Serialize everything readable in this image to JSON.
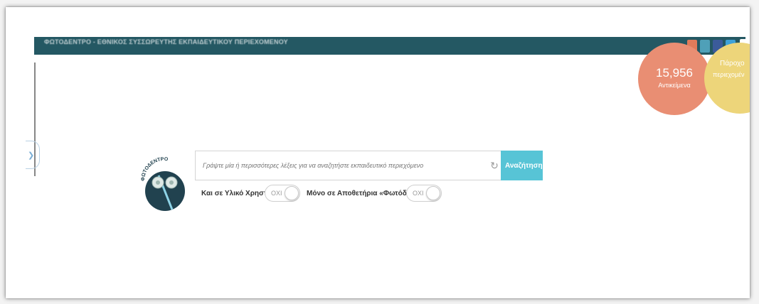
{
  "header": {
    "title": "ΦΩΤΟΔΕΝΤΡΟ - ΕΘΝΙΚΟΣ ΣΥΣΣΩΡΕΥΤΗΣ ΕΚΠΑΙΔΕΥΤΙΚΟΥ ΠΕΡΙΕΧΟΜΕΝΟΥ",
    "search_placeholder": "Αναζήτ...",
    "social_icons": [
      "rss-icon",
      "email-icon",
      "facebook-icon",
      "twitter-icon"
    ]
  },
  "stats": {
    "objects_count": "15,956",
    "objects_label": "Αντικείμενα",
    "providers_line1": "Πάροχο",
    "providers_line2": "περιεχομέν"
  },
  "logo": {
    "text": "ΦΩΤΟΔΕΝΤΡΟ"
  },
  "search": {
    "placeholder": "Γράψτε μία ή περισσότερες λέξεις για να αναζητήστε εκπαιδευτικό περιεχόμενο",
    "button_label": "Αναζήτηση"
  },
  "options": {
    "user_material_label": "Και σε Υλικό Χρηστών",
    "user_material_value": "ΟΧΙ",
    "repositories_label": "Μόνο σε Αποθετήρια «Φωτόδεντρο»",
    "repositories_value": "ΟΧΙ"
  },
  "colors": {
    "header_bar": "#245863",
    "search_button": "#57c4d6",
    "stat_objects": "#e98e73",
    "stat_providers": "#edd57a",
    "logo_circle": "#21424f"
  }
}
